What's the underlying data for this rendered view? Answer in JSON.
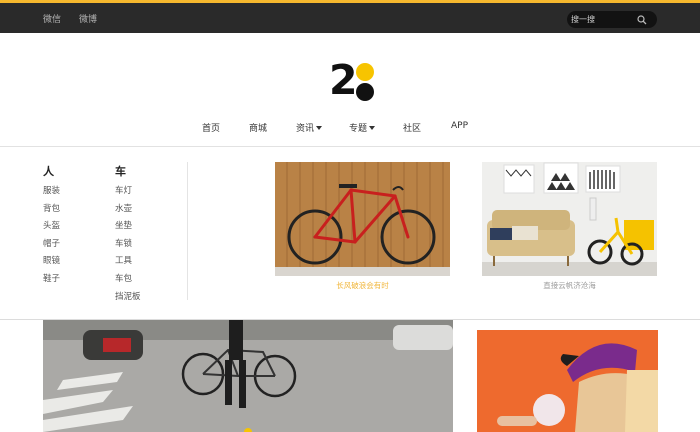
{
  "topbar": {
    "links": [
      "微信",
      "微博"
    ],
    "search_placeholder": "搜一搜"
  },
  "logo": {
    "text": "2"
  },
  "nav": {
    "items": [
      {
        "label": "首页"
      },
      {
        "label": "商城"
      },
      {
        "label": "资讯"
      },
      {
        "label": "专题"
      },
      {
        "label": "社区"
      },
      {
        "label": "APP"
      }
    ]
  },
  "dropdown": {
    "columns": [
      {
        "heading": "人",
        "items": [
          "服装",
          "背包",
          "头盔",
          "帽子",
          "眼镜",
          "鞋子"
        ]
      },
      {
        "heading": "车",
        "items": [
          "车灯",
          "水壶",
          "坐垫",
          "车锁",
          "工具",
          "车包",
          "挡泥板"
        ]
      }
    ],
    "cards": [
      {
        "caption": "长风破浪会有时",
        "caption_color": "#f1b63a"
      },
      {
        "caption": "直接云帆济沧海",
        "caption_color": "#9a9a9a"
      }
    ]
  },
  "colors": {
    "accent": "#f5b82e",
    "topbar_bg": "#2a2a2a",
    "logo_yellow": "#f7c400"
  }
}
